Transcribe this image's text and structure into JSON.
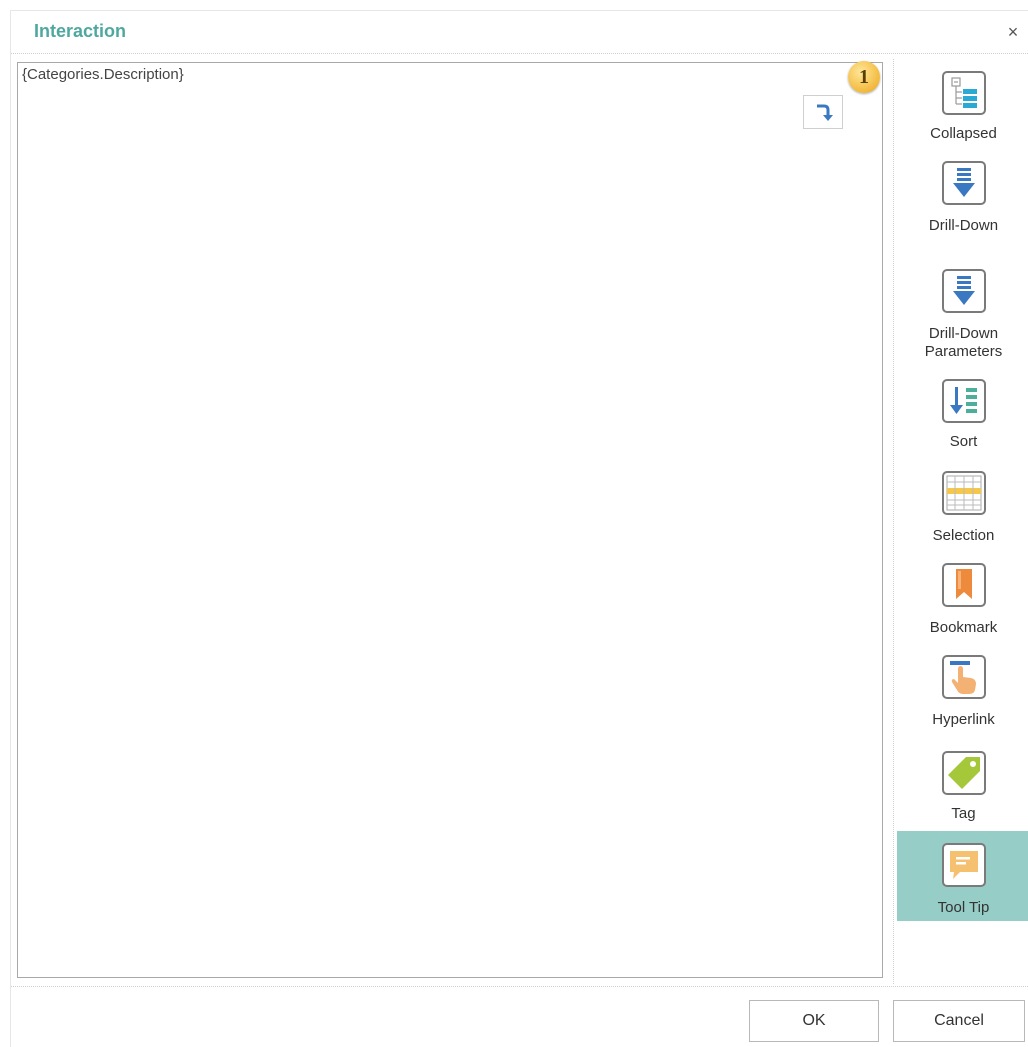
{
  "dialog": {
    "title": "Interaction",
    "close_glyph": "×"
  },
  "editor": {
    "value": "{Categories.Description}",
    "expression_button_icon": "arrow-return-icon",
    "badge_number": "1"
  },
  "sidebar": {
    "items": [
      {
        "label": "Collapsed",
        "icon": "collapsed-tree-icon",
        "active": false
      },
      {
        "label": "Drill-Down",
        "icon": "drill-down-arrow-icon",
        "active": false
      },
      {
        "label": "Drill-Down\nParameters",
        "icon": "drill-down-parameters-icon",
        "active": false
      },
      {
        "label": "Sort",
        "icon": "sort-icon",
        "active": false
      },
      {
        "label": "Selection",
        "icon": "selection-grid-icon",
        "active": false
      },
      {
        "label": "Bookmark",
        "icon": "bookmark-icon",
        "active": false
      },
      {
        "label": "Hyperlink",
        "icon": "hyperlink-hand-icon",
        "active": false
      },
      {
        "label": "Tag",
        "icon": "tag-icon",
        "active": false
      },
      {
        "label": "Tool Tip",
        "icon": "tooltip-bubble-icon",
        "active": true
      }
    ],
    "active_color": "#96cdc6"
  },
  "footer": {
    "ok_label": "OK",
    "cancel_label": "Cancel"
  }
}
